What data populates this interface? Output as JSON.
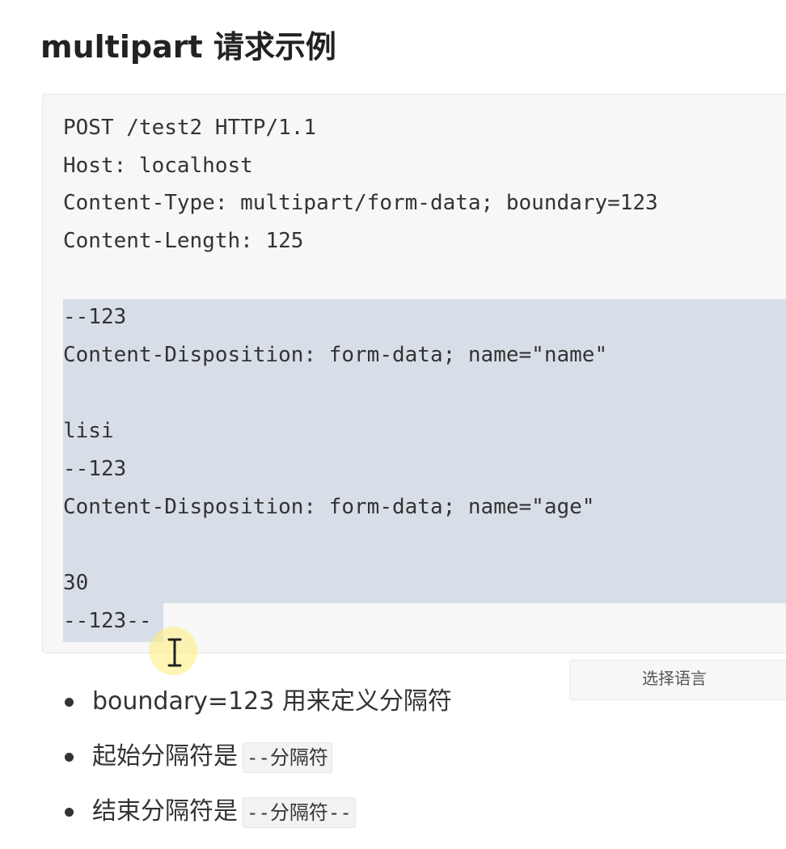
{
  "heading": "multipart 请求示例",
  "code": {
    "lines": [
      "POST /test2 HTTP/1.1",
      "Host: localhost",
      "Content-Type: multipart/form-data; boundary=123",
      "Content-Length: 125",
      "",
      "--123",
      "Content-Disposition: form-data; name=\"name\"",
      "",
      "lisi",
      "--123",
      "Content-Disposition: form-data; name=\"age\"",
      "",
      "30",
      "--123--"
    ]
  },
  "language_select": {
    "label": "选择语言"
  },
  "bullets": [
    {
      "text": "boundary=123 用来定义分隔符",
      "code": ""
    },
    {
      "text": "起始分隔符是",
      "code": "--分隔符"
    },
    {
      "text": "结束分隔符是",
      "code": "--分隔符--"
    }
  ],
  "colors": {
    "selection": "#d8dee7",
    "code_background": "#f7f7f7",
    "cursor_highlight": "#ffee78"
  }
}
